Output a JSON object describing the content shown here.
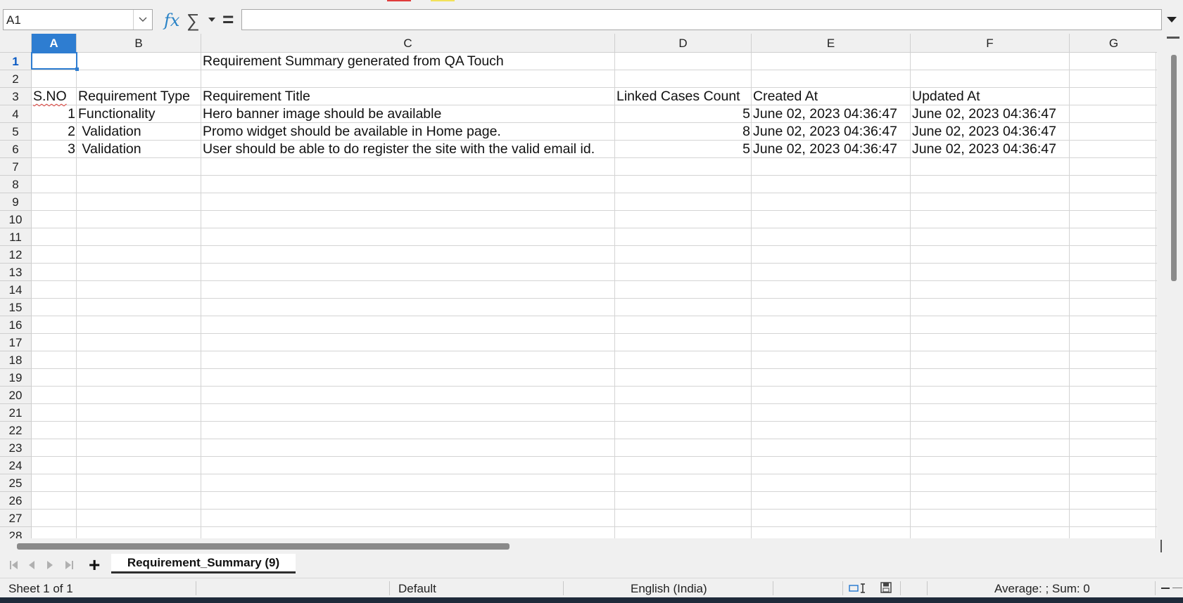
{
  "formula_bar": {
    "name_box": "A1",
    "formula": ""
  },
  "columns": [
    "A",
    "B",
    "C",
    "D",
    "E",
    "F",
    "G"
  ],
  "rows": [
    "1",
    "2",
    "3",
    "4",
    "5",
    "6",
    "7",
    "8",
    "9",
    "10",
    "11",
    "12",
    "13",
    "14",
    "15",
    "16",
    "17",
    "18",
    "19",
    "20",
    "21",
    "22",
    "23",
    "24",
    "25",
    "26",
    "27",
    "28"
  ],
  "sheet": {
    "title": "Requirement Summary generated from QA Touch",
    "headers": {
      "sno": "S.NO",
      "type": "Requirement Type",
      "title": "Requirement Title",
      "linked": "Linked Cases Count",
      "created": "Created At",
      "updated": "Updated At"
    },
    "data_rows": [
      {
        "sno": "1",
        "type": "Functionality",
        "title": "Hero banner image should be available",
        "linked": "5",
        "created": "June 02, 2023 04:36:47",
        "updated": "June 02, 2023 04:36:47"
      },
      {
        "sno": "2",
        "type": " Validation",
        "title": "Promo widget should be available in Home page.",
        "linked": "8",
        "created": "June 02, 2023 04:36:47",
        "updated": "June 02, 2023 04:36:47"
      },
      {
        "sno": "3",
        "type": " Validation",
        "title": "User should be able to do register the site with the valid email id.",
        "linked": "5",
        "created": "June 02, 2023 04:36:47",
        "updated": "June 02, 2023 04:36:47"
      }
    ]
  },
  "tabs": {
    "active": "Requirement_Summary (9)"
  },
  "status_bar": {
    "sheet_info": "Sheet 1 of 1",
    "page_style": "Default",
    "language": "English (India)",
    "summary": "Average: ; Sum: 0"
  },
  "icons": [
    "chevron-down-icon",
    "function-wizard-icon",
    "sum-icon",
    "equals-icon",
    "expand-formula-icon",
    "first-sheet-icon",
    "previous-sheet-icon",
    "next-sheet-icon",
    "last-sheet-icon",
    "add-sheet-icon",
    "selection-mode-icon",
    "save-status-icon"
  ],
  "colors": {
    "accent": "#2e7dd1",
    "spell_error": "#e0403a"
  }
}
